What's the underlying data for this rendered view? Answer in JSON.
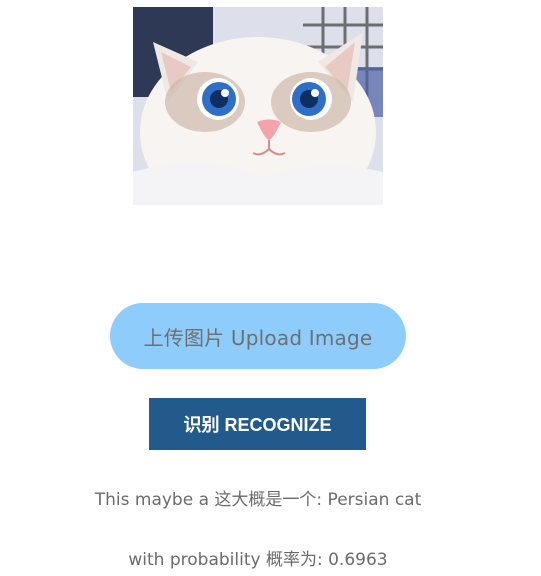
{
  "upload": {
    "label": "上传图片 Upload Image"
  },
  "recognize": {
    "label": "识别 RECOGNIZE"
  },
  "result": {
    "prefix": "This maybe a 这大概是一个: ",
    "label": "Persian cat",
    "prob_prefix": "with probability 概率为: ",
    "probability": "0.6963"
  },
  "colors": {
    "upload_bg": "#8ecdfb",
    "recognize_bg": "#225a8c",
    "text": "#6b6b6b"
  }
}
